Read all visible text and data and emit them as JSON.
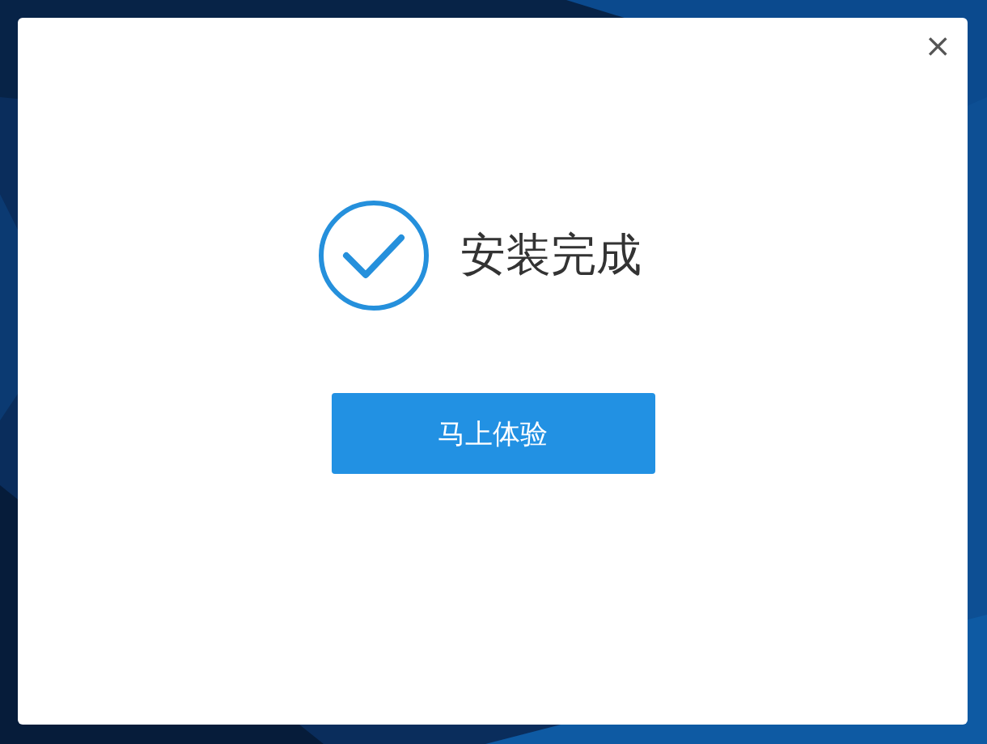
{
  "dialog": {
    "close": "×",
    "message": "安装完成",
    "button": "马上体验"
  }
}
